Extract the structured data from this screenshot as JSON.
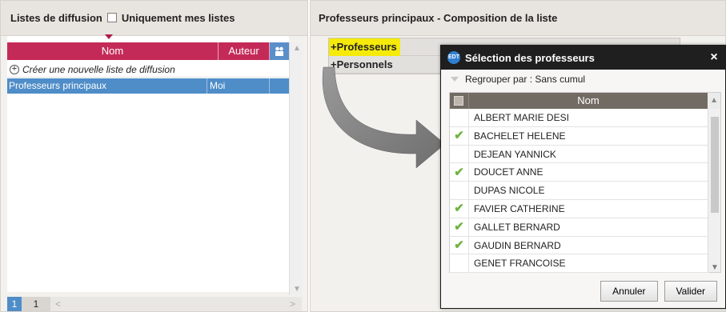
{
  "left_panel": {
    "title": "Listes de diffusion",
    "only_mine_label": "Uniquement mes listes",
    "columns": {
      "nom": "Nom",
      "auteur": "Auteur"
    },
    "create_label": "Créer une nouvelle liste de diffusion",
    "rows": [
      {
        "nom": "Professeurs principaux",
        "auteur": "Moi"
      }
    ],
    "pager": {
      "current": "1",
      "page": "1"
    }
  },
  "right_panel": {
    "title": "Professeurs principaux - Composition de la liste",
    "tree": [
      {
        "label": "+Professeurs",
        "highlighted": true
      },
      {
        "label": "+Personnels",
        "highlighted": false
      }
    ]
  },
  "modal": {
    "title": "Sélection des professeurs",
    "icon_text": "EDT",
    "close_label": "×",
    "group_by": "Regrouper par : Sans cumul",
    "column_label": "Nom",
    "rows": [
      {
        "name": "ALBERT MARIE DESI",
        "checked": false
      },
      {
        "name": "BACHELET HELENE",
        "checked": true
      },
      {
        "name": "DEJEAN YANNICK",
        "checked": false
      },
      {
        "name": "DOUCET ANNE",
        "checked": true
      },
      {
        "name": "DUPAS NICOLE",
        "checked": false
      },
      {
        "name": "FAVIER CATHERINE",
        "checked": true
      },
      {
        "name": "GALLET BERNARD",
        "checked": true
      },
      {
        "name": "GAUDIN BERNARD",
        "checked": true
      },
      {
        "name": "GENET FRANCOISE",
        "checked": false
      }
    ],
    "cancel_label": "Annuler",
    "ok_label": "Valider"
  },
  "colors": {
    "header_pink": "#c42a58",
    "selection_blue": "#4f8dc8",
    "highlight_yellow": "#f5ea0a",
    "check_green": "#6fb43f",
    "modal_title_bg": "#1f1f1f"
  },
  "icons": {
    "only_mine": "checkbox-icon",
    "people": "people-icon",
    "create": "plus-circle-icon",
    "arrow": "curved-arrow-icon",
    "check": "checkmark-icon",
    "close": "close-icon"
  }
}
